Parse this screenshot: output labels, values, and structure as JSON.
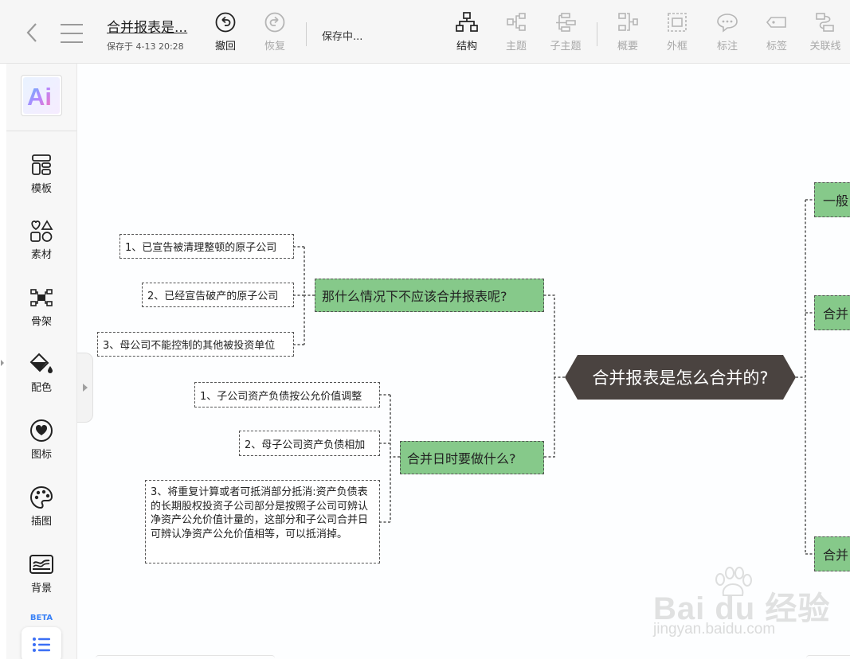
{
  "header": {
    "doc_title": "合并报表是...",
    "saved_at": "保存于 4-13 20:28",
    "undo_label": "撤回",
    "redo_label": "恢复",
    "saving_status": "保存中..."
  },
  "toolbar": {
    "items": [
      {
        "label": "结构",
        "icon": "structure-icon",
        "state": "active"
      },
      {
        "label": "主题",
        "icon": "topic-icon",
        "state": "disabled"
      },
      {
        "label": "子主题",
        "icon": "subtopic-icon",
        "state": "disabled"
      },
      {
        "label": "概要",
        "icon": "summary-icon",
        "state": "disabled"
      },
      {
        "label": "外框",
        "icon": "boundary-icon",
        "state": "disabled"
      },
      {
        "label": "标注",
        "icon": "callout-icon",
        "state": "disabled"
      },
      {
        "label": "标签",
        "icon": "tag-icon",
        "state": "disabled"
      },
      {
        "label": "关联线",
        "icon": "relationship-icon",
        "state": "disabled"
      }
    ]
  },
  "sidebar": {
    "ai_label": "Ai",
    "items": [
      {
        "label": "模板",
        "icon": "template-icon"
      },
      {
        "label": "素材",
        "icon": "material-icon"
      },
      {
        "label": "骨架",
        "icon": "skeleton-icon"
      },
      {
        "label": "配色",
        "icon": "color-scheme-icon"
      },
      {
        "label": "图标",
        "icon": "heart-icon"
      },
      {
        "label": "插图",
        "icon": "palette-icon"
      },
      {
        "label": "背景",
        "icon": "background-icon"
      }
    ],
    "beta_label": "BETA"
  },
  "mindmap": {
    "central": "合并报表是怎么合并的?",
    "left_topics": [
      {
        "label": "那什么情况下不应该合并报表呢?",
        "children": [
          "1、已宣告被清理整顿的原子公司",
          "2、已经宣告破产的原子公司",
          "3、母公司不能控制的其他被投资单位"
        ]
      },
      {
        "label": "合并日时要做什么?",
        "children": [
          "1、子公司资产负债按公允价值调整",
          "2、母子公司资产负债相加",
          "3、将重复计算或者可抵消部分抵消:资产负债表的长期股权投资子公司部分是按照子公司可辨认净资产公允价值计量的，这部分和子公司合并日可辨认净资产公允价值相等，可以抵消掉。"
        ]
      }
    ],
    "right_topics": [
      "一般",
      "合并",
      "合并"
    ]
  },
  "watermark": {
    "main": "Bai du 经验",
    "sub": "jingyan.baidu.com"
  },
  "colors": {
    "topic_fill": "#86c98a",
    "central_fill": "#4a4340",
    "beta_accent": "#3b82f6"
  }
}
